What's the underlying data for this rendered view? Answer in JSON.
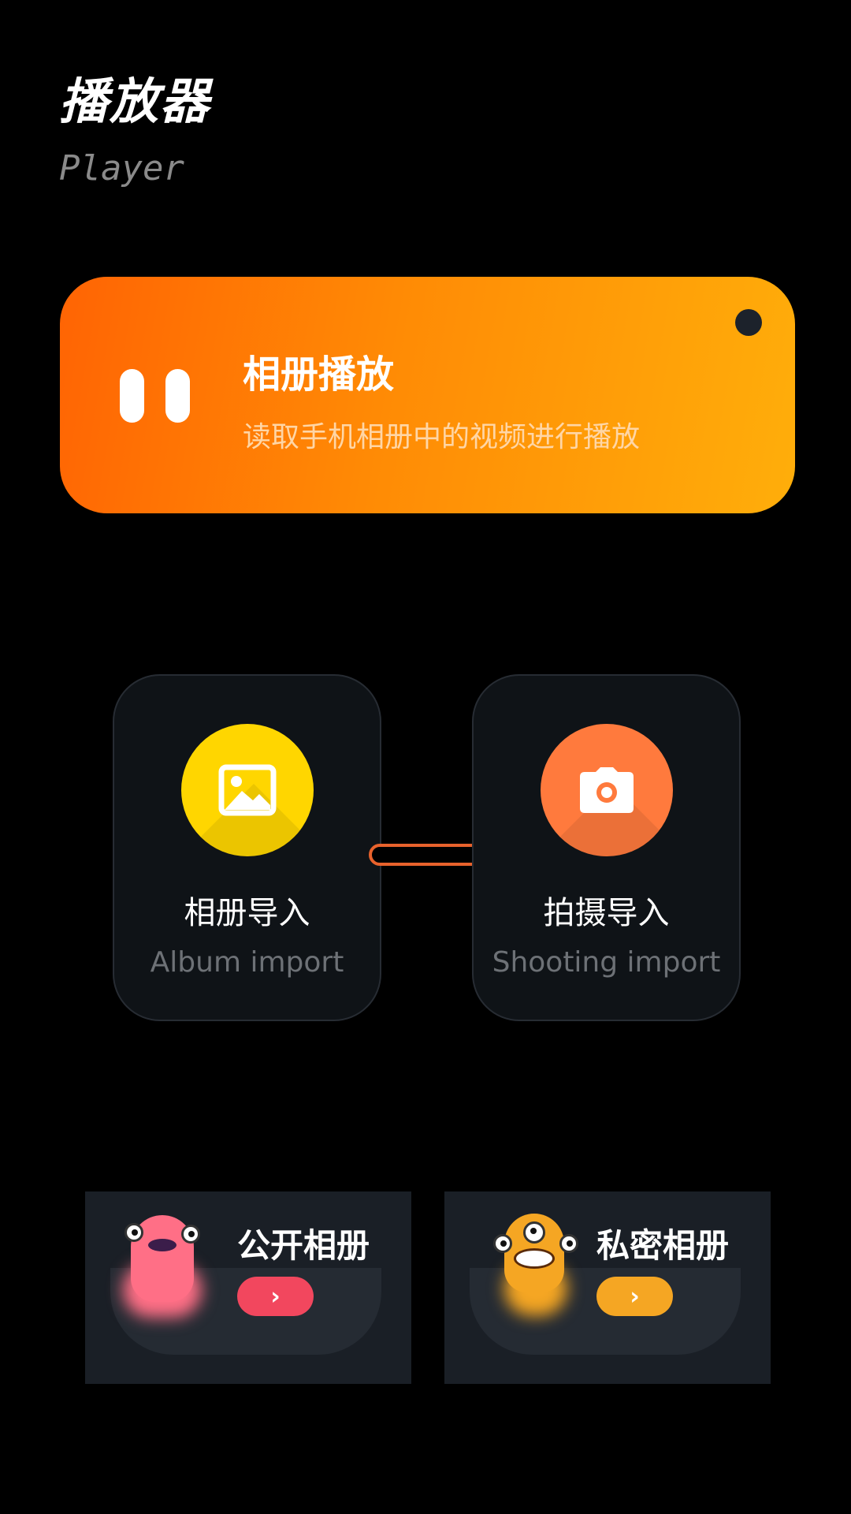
{
  "header": {
    "title": "播放器",
    "subtitle": "Player"
  },
  "banner": {
    "title": "相册播放",
    "description": "读取手机相册中的视频进行播放",
    "icon": "pause-icon"
  },
  "import_cards": [
    {
      "title": "相册导入",
      "subtitle": "Album import",
      "icon": "image-icon",
      "color": "#ffd600"
    },
    {
      "title": "拍摄导入",
      "subtitle": "Shooting import",
      "icon": "camera-icon",
      "color": "#ff7a3d"
    }
  ],
  "albums": [
    {
      "title": "公开相册",
      "button": "›",
      "color": "#f2475e"
    },
    {
      "title": "私密相册",
      "button": "›",
      "color": "#f5a623"
    }
  ]
}
